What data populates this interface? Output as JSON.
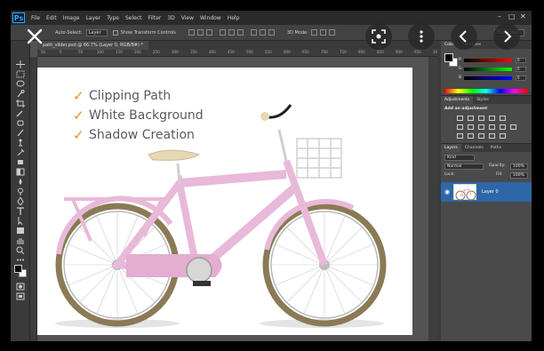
{
  "app": {
    "logo": "Ps",
    "menu": [
      "File",
      "Edit",
      "Image",
      "Layer",
      "Type",
      "Select",
      "Filter",
      "3D",
      "View",
      "Window",
      "Help"
    ],
    "window_controls": [
      "–",
      "□",
      "✕"
    ]
  },
  "options_bar": {
    "auto_select_label": "Auto-Select:",
    "auto_select_value": "Layer",
    "transform_label": "Show Transform Controls",
    "mode_3d": "3D Mode:",
    "workspace": "Essentials"
  },
  "document_tab": {
    "label": "path_slider.psd @ 66.7% (Layer 0, RGB/8#) *"
  },
  "ruler_ticks": [
    "50",
    "0",
    "50",
    "100",
    "150",
    "200",
    "250",
    "300",
    "350",
    "400",
    "450",
    "500",
    "550",
    "600",
    "650",
    "700",
    "750",
    "800",
    "850",
    "900",
    "950",
    "1000"
  ],
  "canvas": {
    "bullets": [
      {
        "icon": "✓",
        "text": "Clipping Path"
      },
      {
        "icon": "✓",
        "text": "White Background"
      },
      {
        "icon": "✓",
        "text": "Shadow Creation"
      }
    ]
  },
  "panels": {
    "color_tabs": [
      "Color",
      "Swatches"
    ],
    "sliders": [
      {
        "label": "R",
        "value": "0"
      },
      {
        "label": "G",
        "value": "0"
      },
      {
        "label": "B",
        "value": "0"
      }
    ],
    "adjust_tabs": [
      "Adjustments",
      "Styles"
    ],
    "adjust_title": "Add an adjustment",
    "layer_tabs": [
      "Layers",
      "Channels",
      "Paths"
    ],
    "kind_label": "Kind",
    "blend_mode": "Normal",
    "opacity_label": "Opacity:",
    "opacity_value": "100%",
    "lock_label": "Lock:",
    "fill_label": "Fill:",
    "fill_value": "100%",
    "layer_name": "Layer 0"
  },
  "overlay": {
    "close_icon": "close-icon",
    "buttons": [
      "scan-icon",
      "more-vertical-icon",
      "chevron-left-icon",
      "chevron-right-icon"
    ]
  },
  "colors": {
    "check_orange": "#f08a1e",
    "bike_pink": "#e8b9d8",
    "tire_olive": "#8a7a55",
    "layer_selected": "#2d67a8"
  }
}
